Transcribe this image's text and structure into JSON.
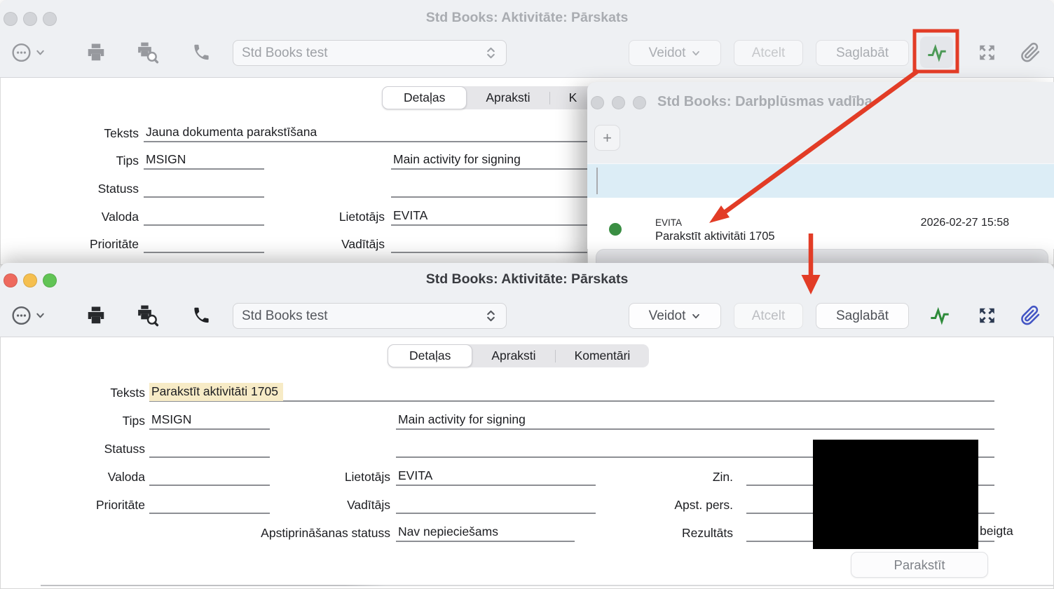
{
  "colors": {
    "annotation_red": "#e23c26",
    "pulse_green": "#2e8b3a",
    "attachment_blue": "#4355c4",
    "expand_navy": "#2c3a52",
    "highlight_yellow": "#f7ebc6",
    "workflow_band_blue": "#dcedf6",
    "status_dot_green": "#3a8e43"
  },
  "back_window": {
    "title": "Std Books: Aktivitāte: Pārskats",
    "toolbar": {
      "record_selector_value": "Std Books test",
      "create_label": "Veidot",
      "cancel_label": "Atcelt",
      "save_label": "Saglabāt"
    },
    "tabs": [
      {
        "label": "Detaļas"
      },
      {
        "label": "Apraksti"
      },
      {
        "label": "K"
      }
    ],
    "fields": {
      "teksts": {
        "label": "Teksts",
        "value": "Jauna dokumenta parakstīšana"
      },
      "tips": {
        "label": "Tips",
        "value": "MSIGN",
        "description": "Main activity for signing"
      },
      "statuss": {
        "label": "Statuss",
        "value": ""
      },
      "valoda": {
        "label": "Valoda",
        "value": ""
      },
      "lietotajs": {
        "label": "Lietotājs",
        "value": "EVITA"
      },
      "prioritate": {
        "label": "Prioritāte",
        "value": ""
      },
      "vaditajs": {
        "label": "Vadītājs",
        "value": ""
      }
    }
  },
  "workflow_window": {
    "title": "Std Books: Darbplūsmas vadība",
    "add_button_label": "+",
    "entry": {
      "user": "EVITA",
      "subject": "Parakstīt aktivitāti 1705",
      "timestamp": "2026-02-27 15:58"
    }
  },
  "front_window": {
    "title": "Std Books: Aktivitāte: Pārskats",
    "toolbar": {
      "record_selector_value": "Std Books test",
      "create_label": "Veidot",
      "cancel_label": "Atcelt",
      "save_label": "Saglabāt"
    },
    "tabs": [
      {
        "label": "Detaļas"
      },
      {
        "label": "Apraksti"
      },
      {
        "label": "Komentāri"
      }
    ],
    "fields": {
      "teksts": {
        "label": "Teksts",
        "value": "Parakstīt aktivitāti 1705"
      },
      "tips": {
        "label": "Tips",
        "value": "MSIGN",
        "description": "Main activity for signing"
      },
      "statuss": {
        "label": "Statuss",
        "value": ""
      },
      "valoda": {
        "label": "Valoda",
        "value": ""
      },
      "lietotajs": {
        "label": "Lietotājs",
        "value": "EVITA"
      },
      "prioritate": {
        "label": "Prioritāte",
        "value": ""
      },
      "vaditajs": {
        "label": "Vadītājs",
        "value": ""
      },
      "apstiprinasanas_statuss": {
        "label": "Apstiprināšanas statuss",
        "value": "Nav nepieciešams"
      },
      "zin": {
        "label": "Zin.",
        "value": ""
      },
      "apst_pers": {
        "label": "Apst. pers.",
        "value": ""
      },
      "rezultats": {
        "label": "Rezultāts",
        "value": ""
      }
    },
    "partial_label": "beigta",
    "sign_button_label": "Parakstīt"
  }
}
